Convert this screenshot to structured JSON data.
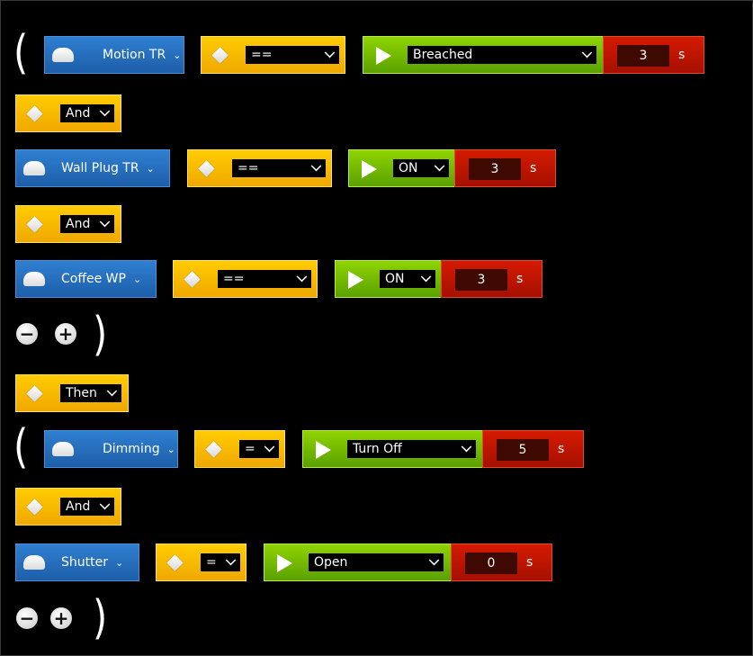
{
  "group1": {
    "open_paren": "(",
    "close_paren": ")",
    "conditions": [
      {
        "device": "Motion TR",
        "operator": "==",
        "value": "Breached",
        "delay": "3",
        "unit": "s"
      },
      {
        "device": "Wall Plug TR",
        "operator": "==",
        "value": "ON",
        "delay": "3",
        "unit": "s"
      },
      {
        "device": "Coffee WP",
        "operator": "==",
        "value": "ON",
        "delay": "3",
        "unit": "s"
      }
    ],
    "connectors": [
      "And",
      "And"
    ]
  },
  "then_label": "Then",
  "group2": {
    "open_paren": "(",
    "close_paren": ")",
    "actions": [
      {
        "device": "Dimming",
        "operator": "=",
        "value": "Turn Off",
        "delay": "5",
        "unit": "s"
      },
      {
        "device": "Shutter",
        "operator": "=",
        "value": "Open",
        "delay": "0",
        "unit": "s"
      }
    ],
    "connectors": [
      "And"
    ]
  },
  "icons": {
    "device": "device-icon",
    "diamond": "diamond-icon",
    "play": "play-icon",
    "remove": "minus-circle-icon",
    "add": "plus-circle-icon"
  },
  "colors": {
    "device": "#2a74c4",
    "operator": "#f5b800",
    "value": "#6fba00",
    "delay": "#c01500",
    "background": "#000000"
  }
}
